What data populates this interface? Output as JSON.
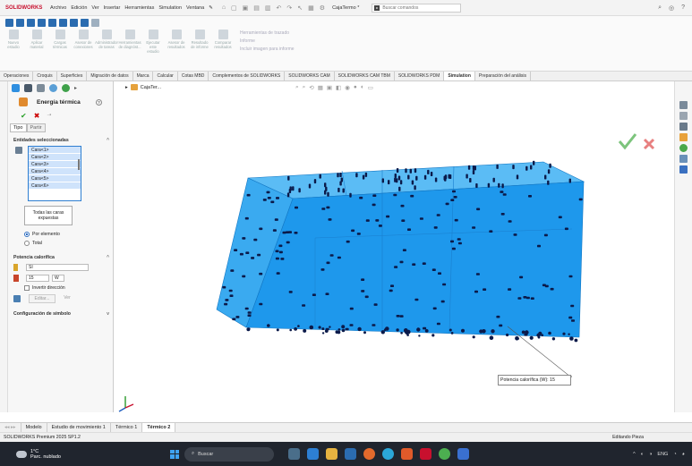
{
  "app": {
    "logo": "SOLIDWORKS",
    "menu": [
      "Archivo",
      "Edición",
      "Ver",
      "Insertar",
      "Herramientas",
      "Simulation",
      "Ventana"
    ],
    "document_title": "CajaTermo *",
    "search_placeholder": "Buscar comandos"
  },
  "ribbon": {
    "items": [
      "Nuevo estudio",
      "Aplicar material",
      "Cargas térmicas",
      "Asesor de conexiones",
      "Administrador de tareas",
      "Herramientas de diagnóst...",
      "Ejecutar este estudio",
      "Asesor de resultados",
      "Resultado de informe",
      "Comparar resultados"
    ],
    "side_items": [
      "Herramientas de trazado",
      "Informe",
      "Incluir imagen para informe"
    ]
  },
  "command_tabs": [
    "Operaciones",
    "Croquis",
    "Superficies",
    "Migración de datos",
    "Marca",
    "Calcular",
    "Cotas MBD",
    "Complementos de SOLIDWORKS",
    "SOLIDWORKS CAM",
    "SOLIDWORKS CAM TBM",
    "SOLIDWORKS PDM",
    "Simulation",
    "Preparación del análisis"
  ],
  "active_command_tab": "Simulation",
  "panel": {
    "title": "Energía térmica",
    "tabs": [
      "Tipo",
      "Partir"
    ],
    "selected_entities_header": "Entidades seleccionadas",
    "entities": [
      "Cara<1>",
      "Cara<2>",
      "Cara<3>",
      "Cara<4>",
      "Cara<5>",
      "Cara<6>"
    ],
    "all_faces_button": "Todas las caras expuestas",
    "radio_per_element": "Por elemento",
    "radio_total": "Total",
    "heat_power_header": "Potencia calorífica",
    "unit_system": "SI",
    "value": "15",
    "unit": "W",
    "invert_label": "Invertir dirección",
    "edit_button": "Editar...",
    "view_button": "Ver",
    "symbol_config_header": "Configuración de símbolo"
  },
  "viewport": {
    "part_name": "CajaTer...",
    "callout": "Potencia calorífica (W): 15"
  },
  "bottom_tabs": [
    "Modelo",
    "Estudio de movimiento 1",
    "Térmico 1",
    "Térmico 2"
  ],
  "active_bottom_tab": "Térmico 2",
  "status": {
    "left": "SOLIDWORKS Premium 2025 SP1.2",
    "right": "Editando Pieza"
  },
  "taskbar": {
    "temperature": "1°C",
    "weather": "Parc. nublado",
    "search": "Buscar",
    "language": "ENG"
  },
  "colors": {
    "box_fill": "#2aa3f0",
    "box_edge": "#1277c4",
    "marker": "#0b1a4a",
    "accent": "#2f6fc1"
  }
}
